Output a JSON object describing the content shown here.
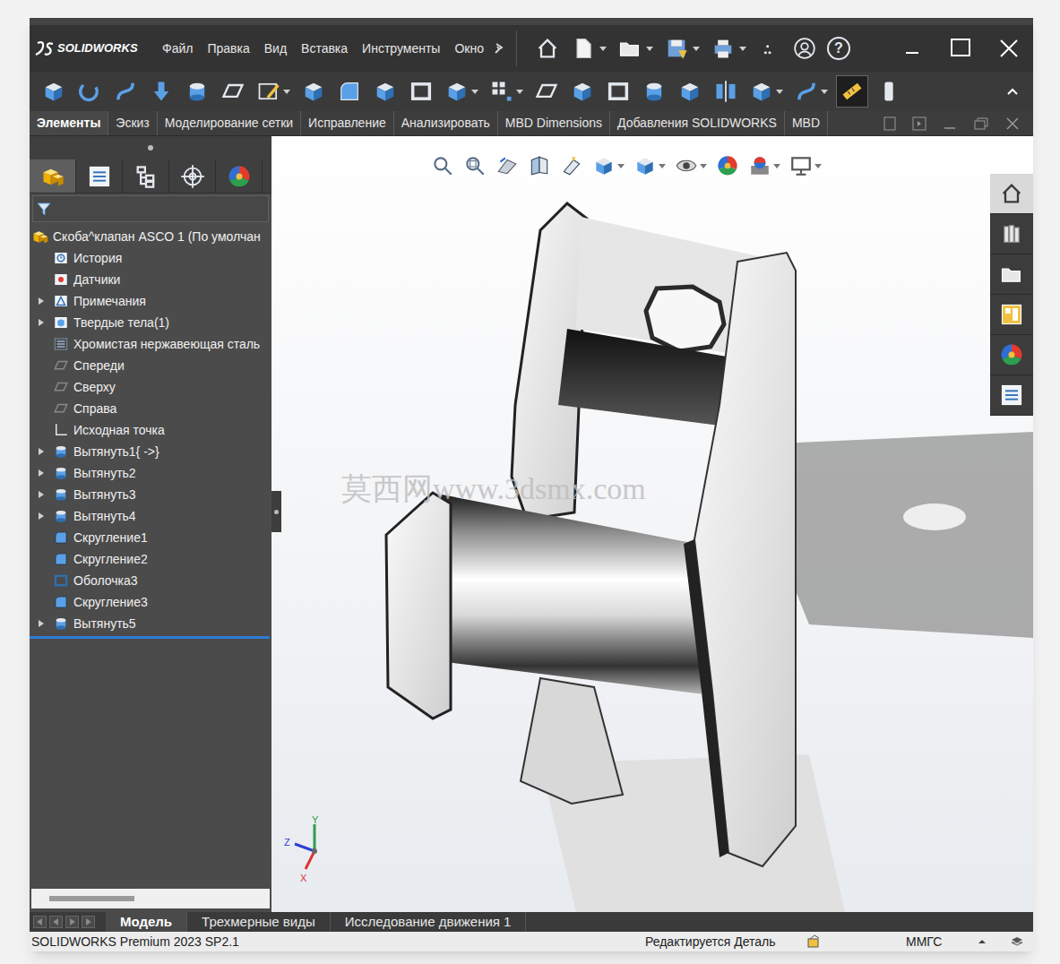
{
  "app": {
    "logo": "SOLIDWORKS"
  },
  "menu": [
    "Файл",
    "Правка",
    "Вид",
    "Вставка",
    "Инструменты",
    "Окно"
  ],
  "quick_access": [
    {
      "kind": "home",
      "dropdown": false,
      "glyph": ""
    },
    {
      "kind": "new",
      "dropdown": true,
      "glyph": ""
    },
    {
      "kind": "open",
      "dropdown": true,
      "glyph": ""
    },
    {
      "kind": "save",
      "dropdown": true,
      "glyph": ""
    },
    {
      "kind": "print",
      "dropdown": true,
      "glyph": ""
    },
    {
      "kind": "more",
      "dropdown": false,
      "glyph": ""
    },
    {
      "kind": "user",
      "dropdown": false,
      "glyph": ""
    },
    {
      "kind": "help",
      "dropdown": false,
      "glyph": "?"
    }
  ],
  "toolbar": [
    {
      "kind": "boss",
      "dropdown": false,
      "selected": false
    },
    {
      "kind": "revolve",
      "dropdown": false,
      "selected": false
    },
    {
      "kind": "sweep",
      "dropdown": false,
      "selected": false
    },
    {
      "kind": "cut",
      "dropdown": false,
      "selected": false
    },
    {
      "kind": "hole",
      "dropdown": false,
      "selected": false
    },
    {
      "kind": "plane",
      "dropdown": false,
      "selected": false
    },
    {
      "kind": "sketch",
      "dropdown": true,
      "selected": false
    },
    {
      "kind": "boss",
      "dropdown": false,
      "selected": false
    },
    {
      "kind": "fillet",
      "dropdown": false,
      "selected": false
    },
    {
      "kind": "boss",
      "dropdown": false,
      "selected": false
    },
    {
      "kind": "shell",
      "dropdown": false,
      "selected": false
    },
    {
      "kind": "cube",
      "dropdown": true,
      "selected": false
    },
    {
      "kind": "pattern",
      "dropdown": true,
      "selected": false
    },
    {
      "kind": "plane",
      "dropdown": false,
      "selected": false
    },
    {
      "kind": "cube",
      "dropdown": false,
      "selected": false
    },
    {
      "kind": "shell",
      "dropdown": false,
      "selected": false
    },
    {
      "kind": "cylinder",
      "dropdown": false,
      "selected": false
    },
    {
      "kind": "cube",
      "dropdown": false,
      "selected": false
    },
    {
      "kind": "mirror",
      "dropdown": false,
      "selected": false
    },
    {
      "kind": "cube",
      "dropdown": true,
      "selected": false
    },
    {
      "kind": "curve",
      "dropdown": true,
      "selected": false
    },
    {
      "kind": "measure",
      "dropdown": false,
      "selected": true
    },
    {
      "kind": "gear",
      "dropdown": false,
      "selected": false
    }
  ],
  "ribbon_tabs": [
    {
      "label": "Элементы",
      "selected": true
    },
    {
      "label": "Эскиз",
      "selected": false
    },
    {
      "label": "Моделирование сетки",
      "selected": false
    },
    {
      "label": "Исправление",
      "selected": false
    },
    {
      "label": "Анализировать",
      "selected": false
    },
    {
      "label": "MBD Dimensions",
      "selected": false
    },
    {
      "label": "Добавления SOLIDWORKS",
      "selected": false
    },
    {
      "label": "MBD",
      "selected": false
    }
  ],
  "panel_tabs": [
    {
      "kind": "part",
      "selected": true
    },
    {
      "kind": "list",
      "selected": false
    },
    {
      "kind": "config",
      "selected": false
    },
    {
      "kind": "target",
      "selected": false
    },
    {
      "kind": "color",
      "selected": false
    }
  ],
  "tree": {
    "root": "Скоба^клапан ASCO 1 (По умолчан",
    "items": [
      {
        "label": "История",
        "kind": "history",
        "expandable": false
      },
      {
        "label": "Датчики",
        "kind": "sensor",
        "expandable": false
      },
      {
        "label": "Примечания",
        "kind": "annotation",
        "expandable": true
      },
      {
        "label": "Твердые тела(1)",
        "kind": "solid",
        "expandable": true
      },
      {
        "label": "Хромистая нержавеющая сталь",
        "kind": "material",
        "expandable": false
      },
      {
        "label": "Спереди",
        "kind": "plane",
        "expandable": false
      },
      {
        "label": "Сверху",
        "kind": "plane",
        "expandable": false
      },
      {
        "label": "Справа",
        "kind": "plane",
        "expandable": false
      },
      {
        "label": "Исходная точка",
        "kind": "origin",
        "expandable": false
      },
      {
        "label": "Вытянуть1{ ->}",
        "kind": "extrude",
        "expandable": true
      },
      {
        "label": "Вытянуть2",
        "kind": "extrude",
        "expandable": true
      },
      {
        "label": "Вытянуть3",
        "kind": "extrude",
        "expandable": true
      },
      {
        "label": "Вытянуть4",
        "kind": "extrude",
        "expandable": true
      },
      {
        "label": "Скругление1",
        "kind": "fillet",
        "expandable": false
      },
      {
        "label": "Скругление2",
        "kind": "fillet",
        "expandable": false
      },
      {
        "label": "Оболочка3",
        "kind": "shell",
        "expandable": false
      },
      {
        "label": "Скругление3",
        "kind": "fillet",
        "expandable": false
      },
      {
        "label": "Вытянуть5",
        "kind": "extrude",
        "expandable": true
      }
    ]
  },
  "viewport": {
    "watermark": "莫西网www.3dsmx.com",
    "axes": {
      "y": "Y",
      "z": "Z",
      "x": "X"
    },
    "view_tools": [
      {
        "kind": "zoom-fit",
        "dropdown": false
      },
      {
        "kind": "zoom-area",
        "dropdown": false
      },
      {
        "kind": "prev-view",
        "dropdown": false
      },
      {
        "kind": "section",
        "dropdown": false
      },
      {
        "kind": "dynamic",
        "dropdown": false
      },
      {
        "kind": "orient",
        "dropdown": true
      },
      {
        "kind": "display",
        "dropdown": true
      },
      {
        "kind": "eye",
        "dropdown": true
      },
      {
        "kind": "appearance",
        "dropdown": false
      },
      {
        "kind": "scene",
        "dropdown": true
      },
      {
        "kind": "monitor",
        "dropdown": true
      }
    ],
    "task_pane": [
      {
        "kind": "home",
        "selected": true
      },
      {
        "kind": "parts",
        "selected": false
      },
      {
        "kind": "open",
        "selected": false
      },
      {
        "kind": "layout",
        "selected": false
      },
      {
        "kind": "color",
        "selected": false
      },
      {
        "kind": "list",
        "selected": false
      }
    ]
  },
  "bottom_tabs": [
    {
      "label": "Модель",
      "selected": true
    },
    {
      "label": "Трехмерные виды",
      "selected": false
    },
    {
      "label": "Исследование движения 1",
      "selected": false
    }
  ],
  "status_bar": {
    "product": "SOLIDWORKS Premium 2023 SP2.1",
    "mode": "Редактируется Деталь",
    "units": "ММГС"
  }
}
